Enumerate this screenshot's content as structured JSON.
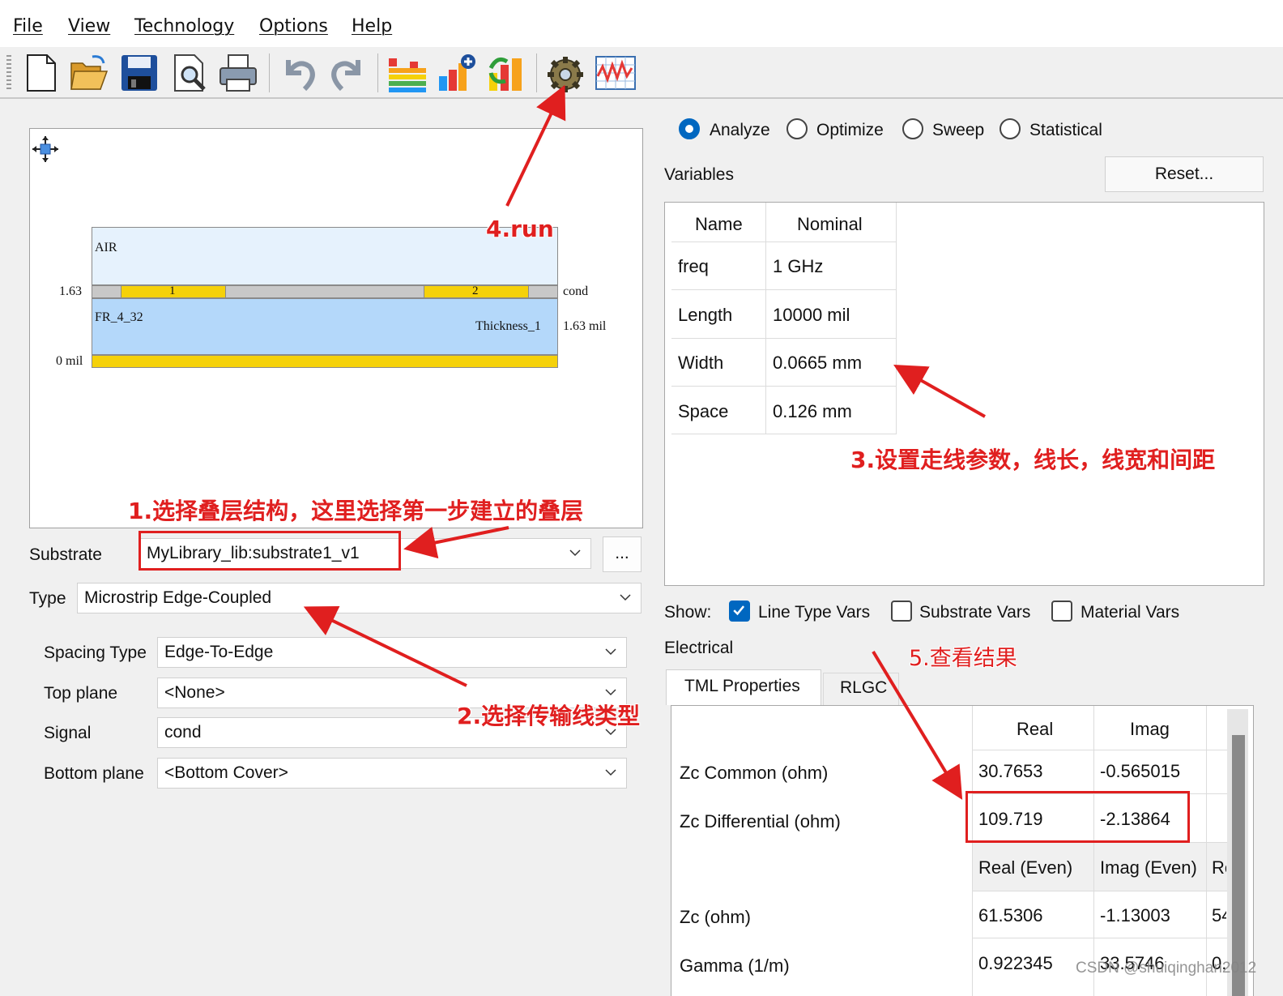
{
  "menu": [
    "File",
    "View",
    "Technology",
    "Options",
    "Help"
  ],
  "toolbar_icons": [
    "new-file-icon",
    "open-folder-icon",
    "save-icon",
    "print-preview-icon",
    "print-icon",
    "undo-icon",
    "redo-icon",
    "layers-chart-icon",
    "add-chart-icon",
    "refresh-chart-icon",
    "run-gear-icon",
    "waveform-icon"
  ],
  "preview": {
    "air_label": "AIR",
    "cond_label": "cond",
    "conductor_1": "1",
    "conductor_2": "2",
    "dielectric_label": "FR_4_32",
    "thickness_label": "Thickness_1",
    "thickness_value": "1.63 mil",
    "top_height": "1.63",
    "bottom_height": "0 mil"
  },
  "form": {
    "substrate_label": "Substrate",
    "substrate_value": "MyLibrary_lib:substrate1_v1",
    "browse_button": "...",
    "type_label": "Type",
    "type_value": "Microstrip Edge-Coupled",
    "spacing_type_label": "Spacing Type",
    "spacing_type_value": "Edge-To-Edge",
    "top_plane_label": "Top plane",
    "top_plane_value": "<None>",
    "signal_label": "Signal",
    "signal_value": "cond",
    "bottom_plane_label": "Bottom plane",
    "bottom_plane_value": "<Bottom Cover>"
  },
  "mode": {
    "options": [
      "Analyze",
      "Optimize",
      "Sweep",
      "Statistical"
    ],
    "selected": "Analyze"
  },
  "variables": {
    "title": "Variables",
    "reset_button": "Reset...",
    "columns": [
      "Name",
      "Nominal"
    ],
    "rows": [
      {
        "name": "freq",
        "nominal": "1 GHz"
      },
      {
        "name": "Length",
        "nominal": "10000 mil"
      },
      {
        "name": "Width",
        "nominal": "0.0665 mm"
      },
      {
        "name": "Space",
        "nominal": "0.126 mm"
      }
    ]
  },
  "show": {
    "label": "Show:",
    "line_type_vars": "Line Type Vars",
    "line_type_vars_checked": true,
    "substrate_vars": "Substrate Vars",
    "substrate_vars_checked": false,
    "material_vars": "Material Vars",
    "material_vars_checked": false
  },
  "electrical": {
    "title": "Electrical",
    "tabs": [
      "TML Properties",
      "RLGC"
    ],
    "active_tab": "TML Properties",
    "header1": [
      "Real",
      "Imag"
    ],
    "zc_common": {
      "label": "Zc Common (ohm)",
      "real": "30.7653",
      "imag": "-0.565015"
    },
    "zc_differential": {
      "label": "Zc Differential (ohm)",
      "real": "109.719",
      "imag": "-2.13864"
    },
    "header2": [
      "Real (Even)",
      "Imag (Even)",
      "Re"
    ],
    "zc": {
      "label": "Zc (ohm)",
      "real": "61.5306",
      "imag": "-1.13003",
      "extra": "54"
    },
    "gamma": {
      "label": "Gamma (1/m)",
      "real": "0.922345",
      "imag": "33.5746",
      "extra": "0."
    }
  },
  "annotations": {
    "step1": "1.选择叠层结构，这里选择第一步建立的叠层",
    "step2": "2.选择传输线类型",
    "step3": "3.设置走线参数，线长，线宽和间距",
    "step4": "4.run",
    "step5": "5.查看结果"
  },
  "watermark": "CSDN @shuiqinghan2012",
  "colors": {
    "accent": "#0067c0",
    "annotation": "#e01f1f",
    "conductor": "#f5d10a",
    "dielectric": "#b4d8fa",
    "air": "#e6f2fd"
  }
}
